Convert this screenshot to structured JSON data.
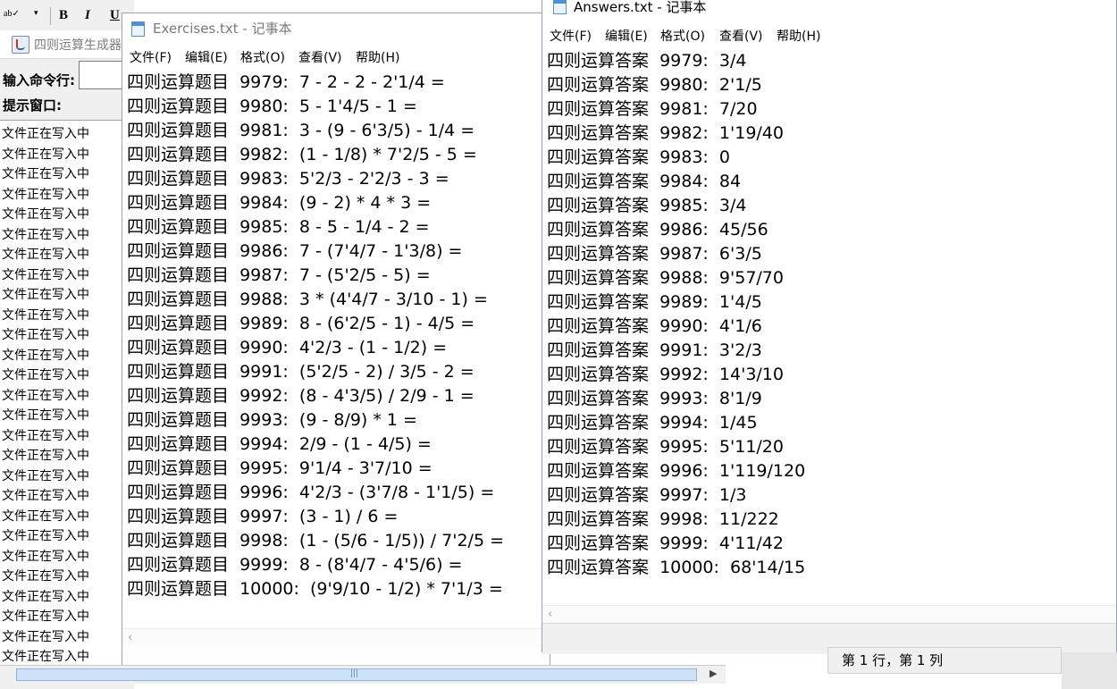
{
  "word_toolbar": {
    "spell_icon": "ab✓",
    "bold": "B",
    "italic": "I",
    "underline": "U"
  },
  "generator_app": {
    "title": "四则运算生成器",
    "command_label": "输入命令行:",
    "command_value": "",
    "tip_label": "提示窗口:",
    "log_lines": [
      "文件正在写入中",
      "文件正在写入中",
      "文件正在写入中",
      "文件正在写入中",
      "文件正在写入中",
      "文件正在写入中",
      "文件正在写入中",
      "文件正在写入中",
      "文件正在写入中",
      "文件正在写入中",
      "文件正在写入中",
      "文件正在写入中",
      "文件正在写入中",
      "文件正在写入中",
      "文件正在写入中",
      "文件正在写入中",
      "文件正在写入中",
      "文件正在写入中",
      "文件正在写入中",
      "文件正在写入中",
      "文件正在写入中",
      "文件正在写入中",
      "文件正在写入中",
      "文件正在写入中",
      "文件正在写入中",
      "文件正在写入中",
      "文件正在写入中"
    ]
  },
  "exercises_window": {
    "title": "Exercises.txt - 记事本",
    "menu": [
      "文件(F)",
      "编辑(E)",
      "格式(O)",
      "查看(V)",
      "帮助(H)"
    ],
    "lines": [
      "四则运算题目  9979:  7 - 2 - 2 - 2'1/4 =",
      "四则运算题目  9980:  5 - 1'4/5 - 1 =",
      "四则运算题目  9981:  3 - (9 - 6'3/5) - 1/4 =",
      "四则运算题目  9982:  (1 - 1/8) * 7'2/5 - 5 =",
      "四则运算题目  9983:  5'2/3 - 2'2/3 - 3 =",
      "四则运算题目  9984:  (9 - 2) * 4 * 3 =",
      "四则运算题目  9985:  8 - 5 - 1/4 - 2 =",
      "四则运算题目  9986:  7 - (7'4/7 - 1'3/8) =",
      "四则运算题目  9987:  7 - (5'2/5 - 5) =",
      "四则运算题目  9988:  3 * (4'4/7 - 3/10 - 1) =",
      "四则运算题目  9989:  8 - (6'2/5 - 1) - 4/5 =",
      "四则运算题目  9990:  4'2/3 - (1 - 1/2) =",
      "四则运算题目  9991:  (5'2/5 - 2) / 3/5 - 2 =",
      "四则运算题目  9992:  (8 - 4'3/5) / 2/9 - 1 =",
      "四则运算题目  9993:  (9 - 8/9) * 1 =",
      "四则运算题目  9994:  2/9 - (1 - 4/5) =",
      "四则运算题目  9995:  9'1/4 - 3'7/10 =",
      "四则运算题目  9996:  4'2/3 - (3'7/8 - 1'1/5) =",
      "四则运算题目  9997:  (3 - 1) / 6 =",
      "四则运算题目  9998:  (1 - (5/6 - 1/5)) / 7'2/5 =",
      "四则运算题目  9999:  8 - (8'4/7 - 4'5/6) =",
      "四则运算题目  10000:  (9'9/10 - 1/2) * 7'1/3 ="
    ]
  },
  "answers_window": {
    "title": "Answers.txt - 记事本",
    "menu": [
      "文件(F)",
      "编辑(E)",
      "格式(O)",
      "查看(V)",
      "帮助(H)"
    ],
    "lines": [
      "四则运算答案  9979:  3/4",
      "四则运算答案  9980:  2'1/5",
      "四则运算答案  9981:  7/20",
      "四则运算答案  9982:  1'19/40",
      "四则运算答案  9983:  0",
      "四则运算答案  9984:  84",
      "四则运算答案  9985:  3/4",
      "四则运算答案  9986:  45/56",
      "四则运算答案  9987:  6'3/5",
      "四则运算答案  9988:  9'57/70",
      "四则运算答案  9989:  1'4/5",
      "四则运算答案  9990:  4'1/6",
      "四则运算答案  9991:  3'2/3",
      "四则运算答案  9992:  14'3/10",
      "四则运算答案  9993:  8'1/9",
      "四则运算答案  9994:  1/45",
      "四则运算答案  9995:  5'11/20",
      "四则运算答案  9996:  1'119/120",
      "四则运算答案  9997:  1/3",
      "四则运算答案  9998:  11/222",
      "四则运算答案  9999:  4'11/42",
      "四则运算答案  10000:  68'14/15"
    ],
    "status_position": "第 1 行，第 1 列"
  }
}
